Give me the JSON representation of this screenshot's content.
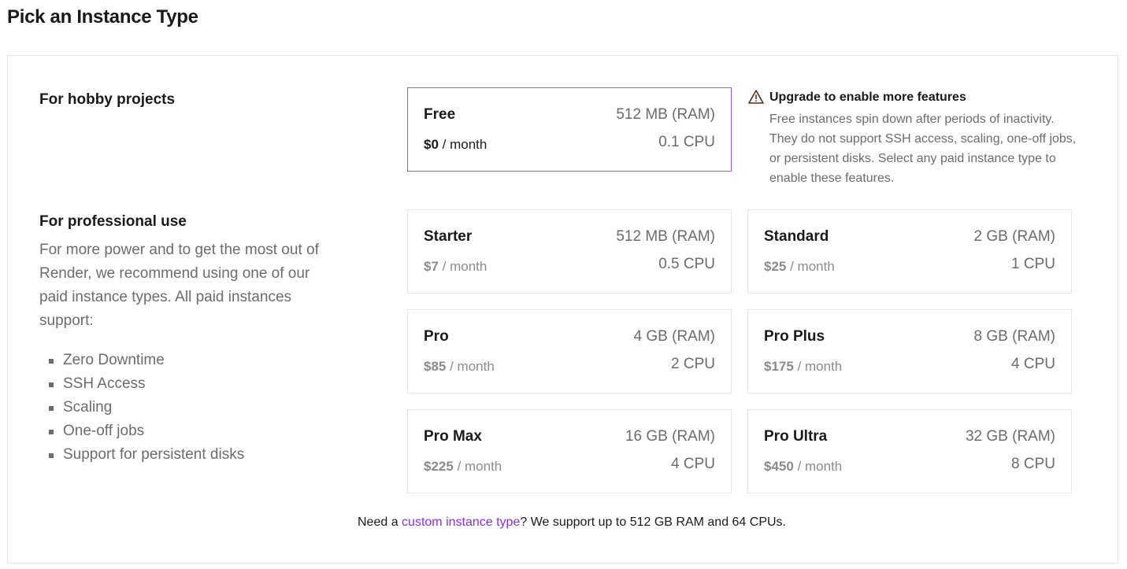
{
  "page": {
    "title": "Pick an Instance Type"
  },
  "hobby": {
    "label": "For hobby projects"
  },
  "professional": {
    "label": "For professional use",
    "description": "For more power and to get the most out of Render, we recommend using one of our paid instance types. All paid instances support:",
    "features": [
      "Zero Downtime",
      "SSH Access",
      "Scaling",
      "One-off jobs",
      "Support for persistent disks"
    ]
  },
  "instances": [
    {
      "name": "Free",
      "price": "$0",
      "period": "/ month",
      "ram": "512 MB (RAM)",
      "cpu": "0.1 CPU",
      "selected": true
    },
    {
      "name": "Starter",
      "price": "$7",
      "period": "/ month",
      "ram": "512 MB (RAM)",
      "cpu": "0.5 CPU"
    },
    {
      "name": "Standard",
      "price": "$25",
      "period": "/ month",
      "ram": "2 GB (RAM)",
      "cpu": "1 CPU"
    },
    {
      "name": "Pro",
      "price": "$85",
      "period": "/ month",
      "ram": "4 GB (RAM)",
      "cpu": "2 CPU"
    },
    {
      "name": "Pro Plus",
      "price": "$175",
      "period": "/ month",
      "ram": "8 GB (RAM)",
      "cpu": "4 CPU"
    },
    {
      "name": "Pro Max",
      "price": "$225",
      "period": "/ month",
      "ram": "16 GB (RAM)",
      "cpu": "4 CPU"
    },
    {
      "name": "Pro Ultra",
      "price": "$450",
      "period": "/ month",
      "ram": "32 GB (RAM)",
      "cpu": "8 CPU"
    }
  ],
  "notice": {
    "icon": "warning-icon",
    "title": "Upgrade to enable more features",
    "body": "Free instances spin down after periods of inactivity. They do not support SSH access, scaling, one-off jobs, or persistent disks. Select any paid instance type to enable these features."
  },
  "footer": {
    "prefix": "Need a ",
    "link": "custom instance type",
    "suffix": "? We support up to 512 GB RAM and 64 CPUs."
  },
  "colors": {
    "accent": "#a64ee8",
    "link": "#8b2be2",
    "muted": "#6b6b6b",
    "warning": "#5a2e1a"
  }
}
